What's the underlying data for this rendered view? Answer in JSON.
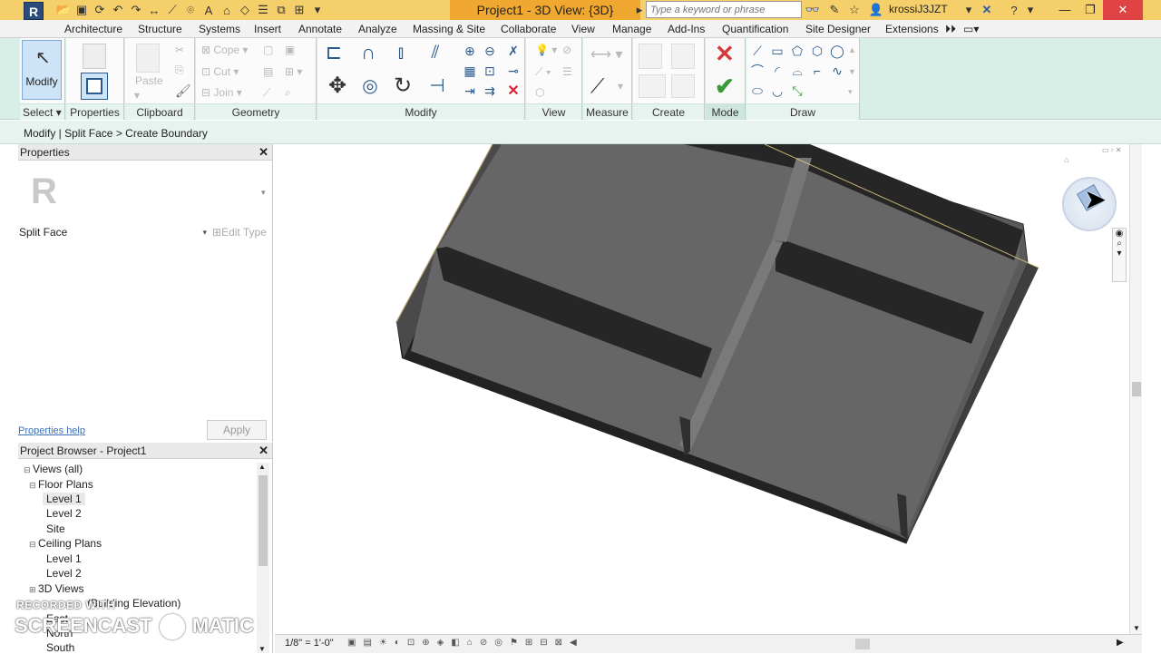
{
  "titlebar": {
    "app_logo": "R",
    "doc_title": "Project1 - 3D View: {3D}",
    "search_placeholder": "Type a keyword or phrase",
    "user": "krossiJ3JZT"
  },
  "tabs": [
    "Architecture",
    "Structure",
    "Systems",
    "Insert",
    "Annotate",
    "Analyze",
    "Massing & Site",
    "Collaborate",
    "View",
    "Manage",
    "Add-Ins",
    "Quantification",
    "Site Designer",
    "Extensions"
  ],
  "ribbon": {
    "modify_label": "Modify",
    "select_label": "Select",
    "properties_label": "Properties",
    "clipboard": {
      "paste": "Paste",
      "cope": "Cope",
      "cut": "Cut",
      "join": "Join",
      "label": "Clipboard"
    },
    "geometry_label": "Geometry",
    "modify_panel_label": "Modify",
    "view_label": "View",
    "measure_label": "Measure",
    "create_label": "Create",
    "mode_label": "Mode",
    "draw_label": "Draw"
  },
  "optionsbar": {
    "context": "Modify | Split Face > Create Boundary"
  },
  "properties": {
    "title": "Properties",
    "logo": "R",
    "type_name": "Split Face",
    "edit_type": "Edit Type",
    "help_link": "Properties help",
    "apply": "Apply"
  },
  "browser": {
    "title": "Project Browser - Project1",
    "items": [
      "Views (all)",
      "Floor Plans",
      "Level 1",
      "Level 2",
      "Site",
      "Ceiling Plans",
      "Level 1",
      "Level 2",
      "3D Views",
      "(Building Elevation)",
      "East",
      "North",
      "South"
    ]
  },
  "viewbar": {
    "scale": "1/8\" = 1'-0\""
  },
  "watermark": {
    "line1": "RECORDED WITH",
    "line2": "SCREENCAST",
    "line3": "MATIC"
  },
  "colors": {
    "title_bg": "#f5d06a",
    "title_active": "#f0a830",
    "ribbon_bg": "#d7efe7",
    "model_fill": "#5a5a5a"
  }
}
